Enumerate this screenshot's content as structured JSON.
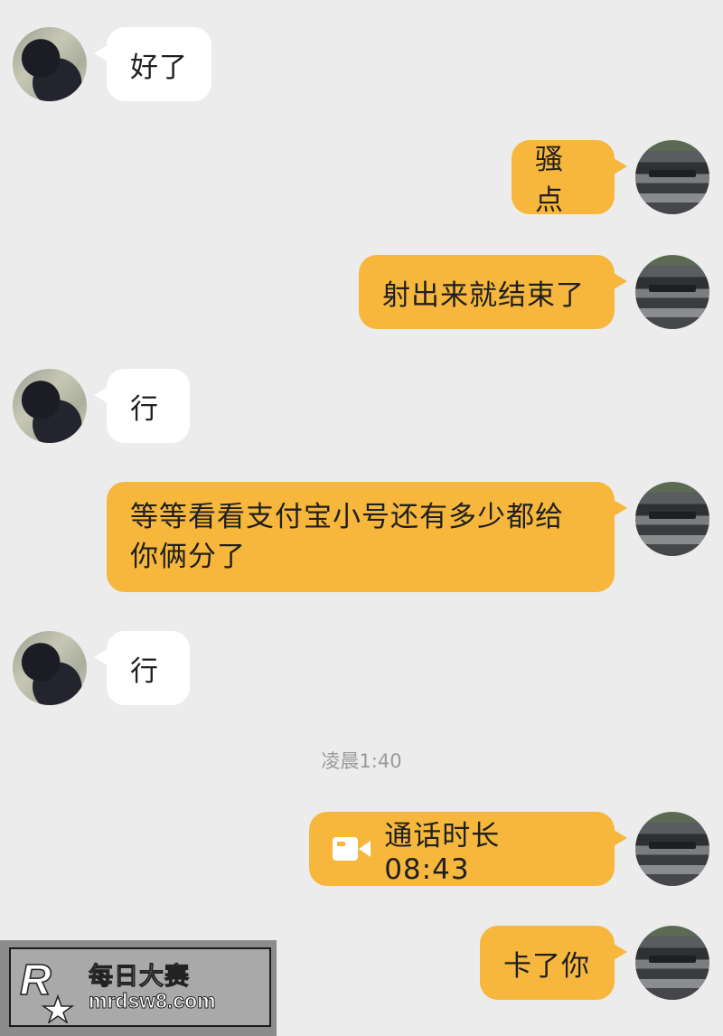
{
  "messages": [
    {
      "side": "in",
      "text": "好了"
    },
    {
      "side": "out",
      "text": "骚点"
    },
    {
      "side": "out",
      "text": "射出来就结束了"
    },
    {
      "side": "in",
      "text": "行"
    },
    {
      "side": "out",
      "lines": [
        "等等看看支付宝小号还有多少都给",
        "你俩分了"
      ]
    },
    {
      "side": "in",
      "text": "行"
    },
    {
      "side": "out",
      "call_icon": "video-call-icon",
      "text": "通话时长 08:43"
    },
    {
      "side": "out",
      "text": "卡了你"
    }
  ],
  "timestamp": "凌晨1:40",
  "watermark": {
    "title": "每日大赛",
    "url": "mrdsw8.com",
    "logo_text": "R"
  }
}
